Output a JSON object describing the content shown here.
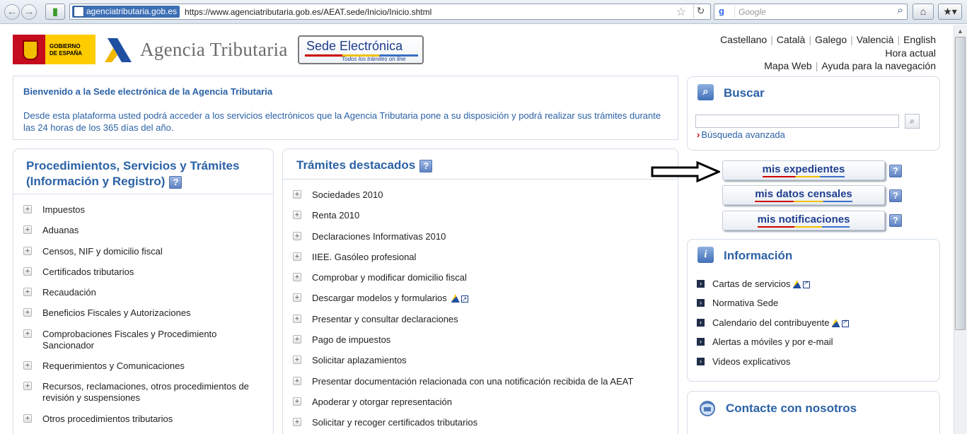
{
  "browser": {
    "back_icon": "back-arrow-icon",
    "forward_icon": "forward-arrow-icon",
    "site_identity": "agenciatributaria.gob.es",
    "url": "https://www.agenciatributaria.gob.es/AEAT.sede/Inicio/Inicio.shtml",
    "search_placeholder": "Google"
  },
  "header": {
    "gobierno_line1": "GOBIERNO",
    "gobierno_line2": "DE ESPAÑA",
    "agency_name": "Agencia Tributaria",
    "sede_title": "Sede Electrónica",
    "sede_subtitle": "Todos los trámites on line",
    "languages": [
      "Castellano",
      "Català",
      "Galego",
      "Valencià",
      "English"
    ],
    "hora_actual": "Hora actual",
    "mapa_web": "Mapa Web",
    "ayuda": "Ayuda para la navegación"
  },
  "welcome": {
    "title": "Bienvenido a la Sede electrónica de la Agencia Tributaria",
    "body": "Desde esta plataforma usted podrá acceder a los servicios electrónicos que la Agencia Tributaria pone a su disposición y podrá realizar sus trámites durante las 24 horas de los 365 días del año."
  },
  "procedimientos": {
    "title": "Procedimientos, Servicios y Trámites (Información y Registro)",
    "items": [
      "Impuestos",
      "Aduanas",
      "Censos, NIF y domicilio fiscal",
      "Certificados tributarios",
      "Recaudación",
      "Beneficios Fiscales y Autorizaciones",
      "Comprobaciones Fiscales y Procedimiento Sancionador",
      "Requerimientos y Comunicaciones",
      "Recursos, reclamaciones, otros procedimientos de revisión y suspensiones",
      "Otros procedimientos tributarios"
    ]
  },
  "tramites": {
    "title": "Trámites destacados",
    "items": [
      "Sociedades 2010",
      "Renta 2010",
      "Declaraciones Informativas 2010",
      "IIEE. Gasóleo profesional",
      "Comprobar y modificar domicilio fiscal",
      "Descargar modelos y formularios",
      "Presentar y consultar declaraciones",
      "Pago de impuestos",
      "Solicitar aplazamientos",
      "Presentar documentación relacionada con una notificación recibida de la AEAT",
      "Apoderar y otorgar representación",
      "Solicitar y recoger certificados tributarios"
    ]
  },
  "buscar": {
    "title": "Buscar",
    "advanced": "Búsqueda avanzada"
  },
  "mis": {
    "expedientes": "mis expedientes",
    "datos_censales": "mis datos censales",
    "notificaciones": "mis notificaciones"
  },
  "informacion": {
    "title": "Información",
    "items": [
      "Cartas de servicios",
      "Normativa Sede",
      "Calendario del contribuyente",
      "Alertas a móviles y por e-mail",
      "Videos explicativos"
    ]
  },
  "contacte": {
    "title": "Contacte con nosotros"
  },
  "help_glyph": "?",
  "colors": {
    "accent": "#2b62a6",
    "button_text": "#1f3f8f"
  }
}
